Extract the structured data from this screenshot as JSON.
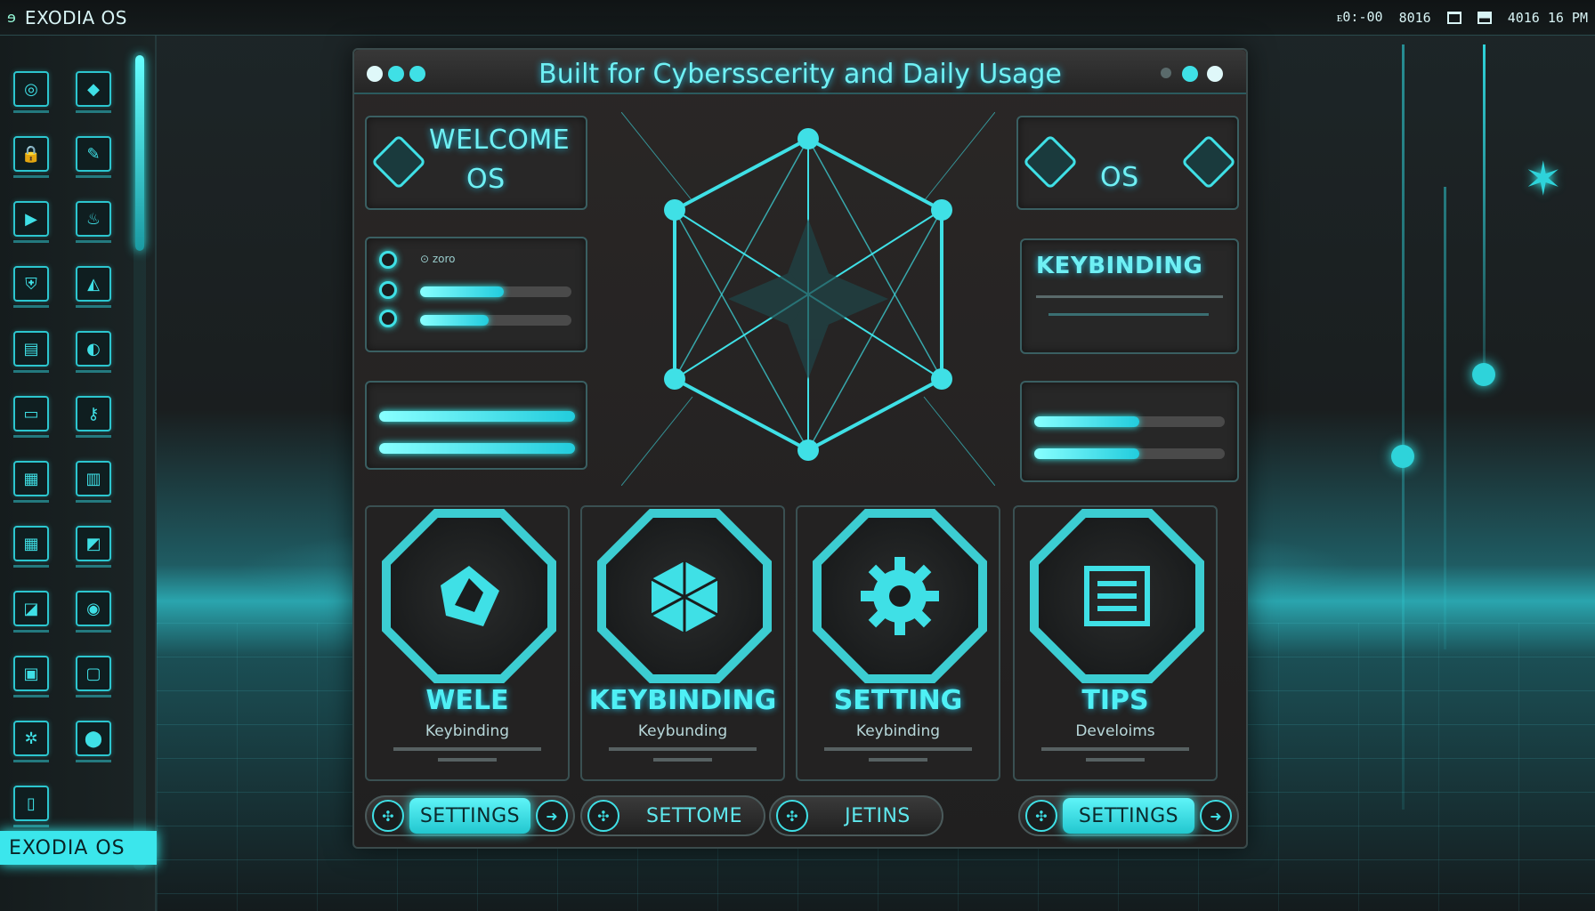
{
  "topbar": {
    "app_name": "EXODIA OS",
    "logo_glyph": "ɘ",
    "clock": "ᴇ0:-00",
    "tray_text": "8016",
    "datetime": "4016 16 PM"
  },
  "dock": {
    "brand_label": "EXODIA OS",
    "apps": [
      {
        "icon": "disc-icon",
        "glyph": "◎"
      },
      {
        "icon": "gem-icon",
        "glyph": "◆"
      },
      {
        "icon": "lock-icon",
        "glyph": "🔒"
      },
      {
        "icon": "pen-icon",
        "glyph": "✎"
      },
      {
        "icon": "play-icon",
        "glyph": "▶"
      },
      {
        "icon": "flame-icon",
        "glyph": "♨"
      },
      {
        "icon": "shield-icon",
        "glyph": "⛨"
      },
      {
        "icon": "drop-icon",
        "glyph": "◭"
      },
      {
        "icon": "terminal-icon",
        "glyph": "▤"
      },
      {
        "icon": "moon-icon",
        "glyph": "◐"
      },
      {
        "icon": "monitor-icon",
        "glyph": "▭"
      },
      {
        "icon": "key-icon",
        "glyph": "⚷"
      },
      {
        "icon": "chart-icon",
        "glyph": "▦"
      },
      {
        "icon": "bars-icon",
        "glyph": "▥"
      },
      {
        "icon": "table-icon",
        "glyph": "▦"
      },
      {
        "icon": "graph-icon",
        "glyph": "◩"
      },
      {
        "icon": "image-icon",
        "glyph": "◪"
      },
      {
        "icon": "globe-icon",
        "glyph": "◉"
      },
      {
        "icon": "folder-icon",
        "glyph": "▣"
      },
      {
        "icon": "camera-icon",
        "glyph": "▢"
      },
      {
        "icon": "fan-icon",
        "glyph": "✲"
      },
      {
        "icon": "pin-icon",
        "glyph": "⬤"
      },
      {
        "icon": "doc-icon",
        "glyph": "▯"
      }
    ]
  },
  "window": {
    "title": "Built for Cybersscerity and Daily Usage",
    "traffic_lights": [
      "#dff8f9",
      "#3fe0e6",
      "#3fe0e6"
    ],
    "welcome_panel": {
      "line1": "WELCOME",
      "line2": "OS"
    },
    "os_panel": {
      "title": "OS"
    },
    "keybinding_panel": {
      "title": "KEYBINDING"
    },
    "status_panel": {
      "label": "⊙ zoro",
      "levels": [
        0.55,
        0.45
      ]
    },
    "left_sliders": {
      "levels": [
        1.0,
        1.0
      ]
    },
    "right_sliders": {
      "levels": [
        0.55,
        0.55
      ]
    }
  },
  "cards": [
    {
      "icon": "arrow-triangle-icon",
      "title": "WELE",
      "subtitle": "Keybinding",
      "button": "SETTINGS",
      "button_active": true
    },
    {
      "icon": "cube-icon",
      "title": "KEYBINDING",
      "subtitle": "Keybunding",
      "button": "SETTOME",
      "button_active": false
    },
    {
      "icon": "gear-icon",
      "title": "SETTING",
      "subtitle": "Keybinding",
      "button": "JETINS",
      "button_active": false
    },
    {
      "icon": "list-icon",
      "title": "TIPS",
      "subtitle": "Develoims",
      "button": "SETTINGS",
      "button_active": true
    }
  ],
  "colors": {
    "accent": "#3fe0e6",
    "bg": "#1a1e1f",
    "panel": "#282828"
  }
}
